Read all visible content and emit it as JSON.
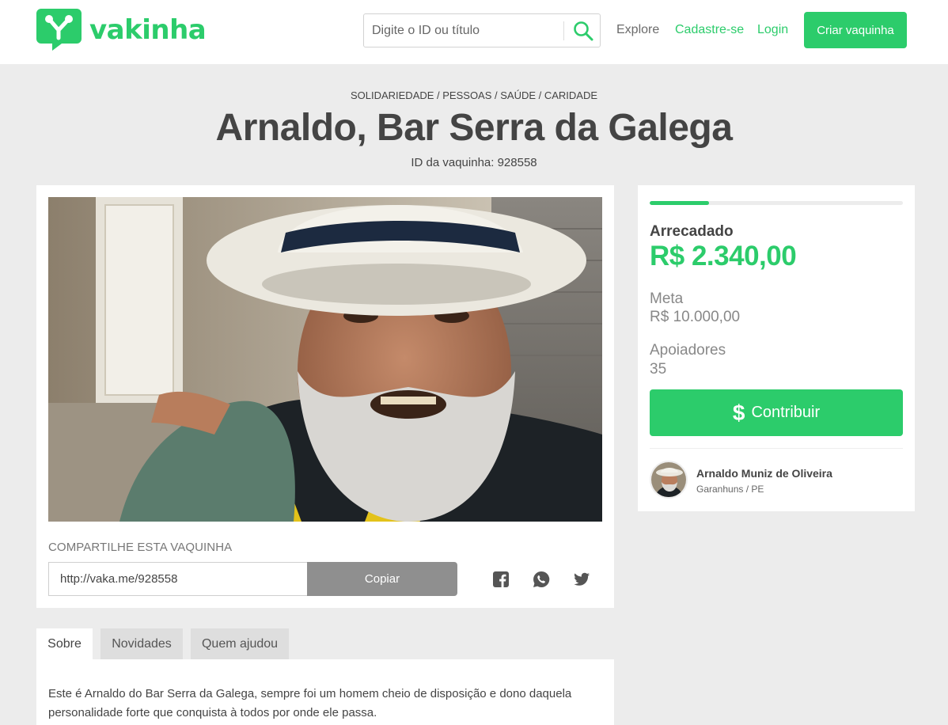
{
  "header": {
    "logo_text": "vakinha",
    "search_placeholder": "Digite o ID ou título",
    "nav": {
      "explore": "Explore",
      "signup": "Cadastre-se",
      "login": "Login"
    },
    "create_button": "Criar vaquinha",
    "brand_color": "#2ccc6b"
  },
  "campaign": {
    "categories": "SOLIDARIEDADE / PESSOAS / SAÚDE / CARIDADE",
    "title": "Arnaldo, Bar Serra da Galega",
    "id_text": "ID da vaquinha: 928558",
    "progress_fraction": 0.234
  },
  "share": {
    "label": "COMPARTILHE ESTA VAQUINHA",
    "url": "http://vaka.me/928558",
    "copy_button": "Copiar",
    "icons": [
      "facebook-icon",
      "whatsapp-icon",
      "twitter-icon"
    ]
  },
  "tabs": [
    {
      "label": "Sobre",
      "active": true
    },
    {
      "label": "Novidades",
      "active": false
    },
    {
      "label": "Quem ajudou",
      "active": false
    }
  ],
  "about": {
    "text": "Este é Arnaldo do Bar Serra da Galega, sempre foi um homem cheio de disposição e dono daquela personalidade forte que conquista à todos por onde ele passa."
  },
  "stats": {
    "raised_label": "Arrecadado",
    "raised_value": "R$ 2.340,00",
    "goal_label": "Meta",
    "goal_value": "R$ 10.000,00",
    "supporters_label": "Apoiadores",
    "supporters_value": "35",
    "contribute_button": "Contribuir",
    "contribute_symbol": "$"
  },
  "owner": {
    "name": "Arnaldo Muniz de Oliveira",
    "location": "Garanhuns / PE"
  }
}
